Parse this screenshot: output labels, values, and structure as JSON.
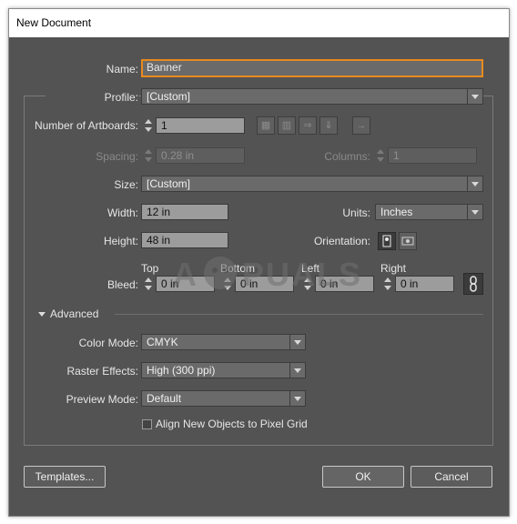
{
  "window": {
    "title": "New Document"
  },
  "name": {
    "label": "Name:",
    "value": "Banner"
  },
  "profile": {
    "label": "Profile:",
    "value": "[Custom]"
  },
  "artboards": {
    "label": "Number of Artboards:",
    "value": "1"
  },
  "spacing": {
    "label": "Spacing:",
    "value": "0.28 in"
  },
  "columns": {
    "label": "Columns:",
    "value": "1"
  },
  "size": {
    "label": "Size:",
    "value": "[Custom]"
  },
  "width": {
    "label": "Width:",
    "value": "12 in"
  },
  "units": {
    "label": "Units:",
    "value": "Inches"
  },
  "height": {
    "label": "Height:",
    "value": "48 in"
  },
  "orientation": {
    "label": "Orientation:"
  },
  "bleed": {
    "label": "Bleed:",
    "top": {
      "label": "Top",
      "value": "0 in"
    },
    "bottom": {
      "label": "Bottom",
      "value": "0 in"
    },
    "left": {
      "label": "Left",
      "value": "0 in"
    },
    "right": {
      "label": "Right",
      "value": "0 in"
    }
  },
  "advanced": {
    "label": "Advanced"
  },
  "color_mode": {
    "label": "Color Mode:",
    "value": "CMYK"
  },
  "raster_effects": {
    "label": "Raster Effects:",
    "value": "High (300 ppi)"
  },
  "preview_mode": {
    "label": "Preview Mode:",
    "value": "Default"
  },
  "align_pixel_grid": {
    "label": "Align New Objects to Pixel Grid",
    "checked": false
  },
  "buttons": {
    "templates": "Templates...",
    "ok": "OK",
    "cancel": "Cancel"
  },
  "watermark": {
    "text": "A PUALS"
  },
  "icons": {
    "artboard_layout": [
      "grid-by-row-icon",
      "grid-by-column-icon",
      "arrange-by-row-icon",
      "arrange-by-column-icon",
      "right-to-left-icon"
    ],
    "orientation": [
      "portrait-icon",
      "landscape-icon"
    ],
    "bleed_link": "chain-link-icon"
  },
  "colors": {
    "dialog_bg": "#535353",
    "focus_ring": "#e88a1e",
    "field_bg": "#9c9c9c"
  }
}
